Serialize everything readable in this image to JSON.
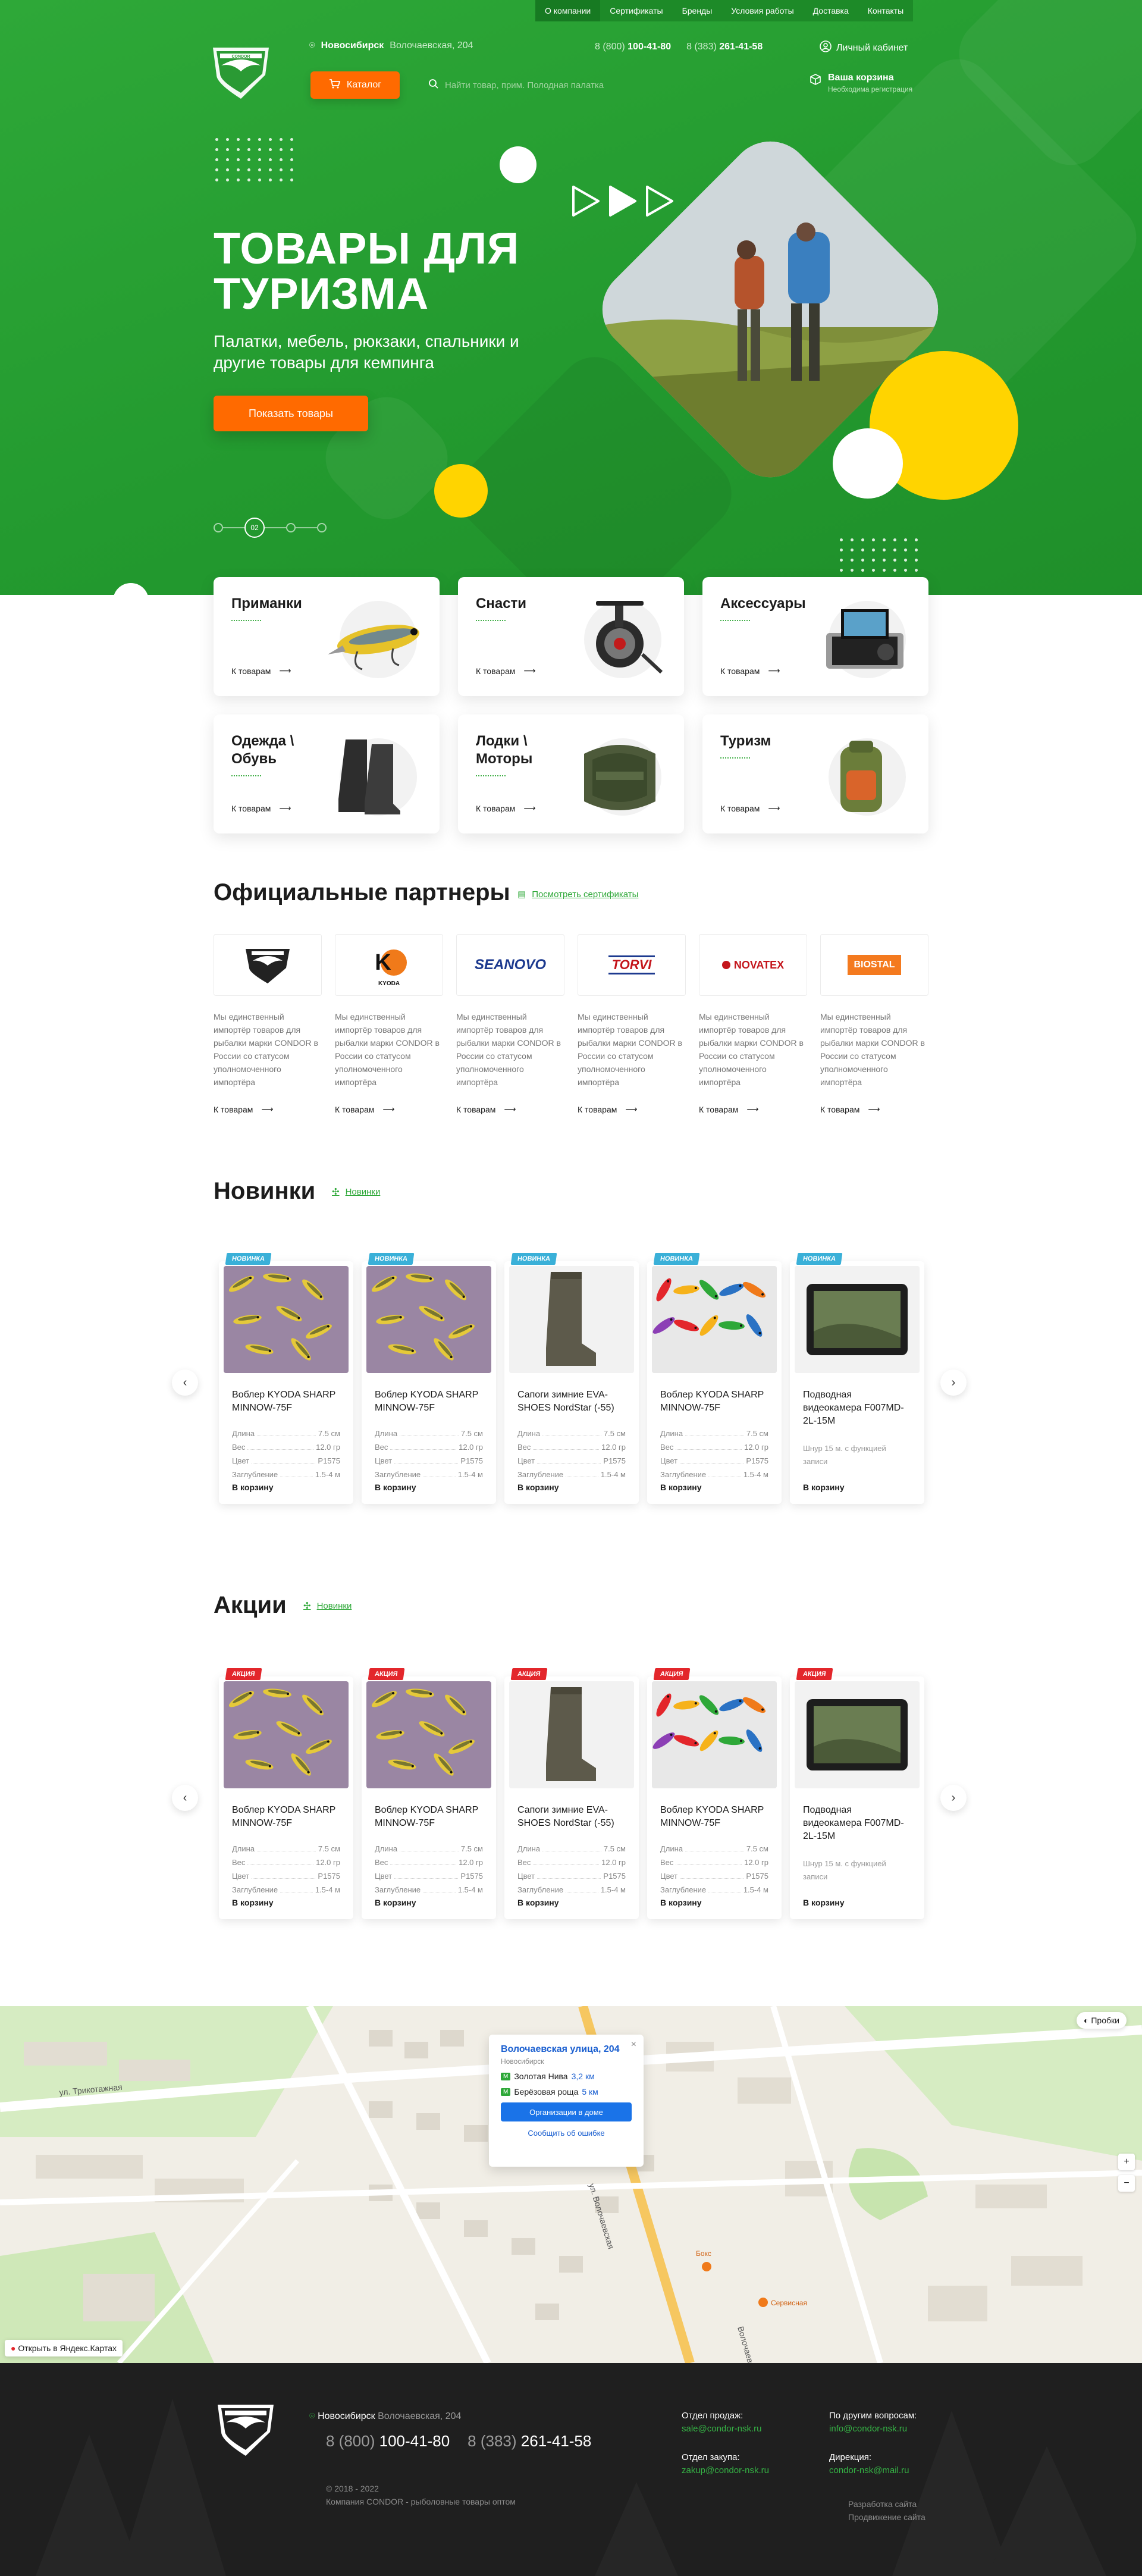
{
  "topnav": {
    "items": [
      "О компании",
      "Сертификаты",
      "Бренды",
      "Условия работы",
      "Доставка",
      "Контакты"
    ]
  },
  "header": {
    "city": "Новосибирск",
    "address": "Волочаевская, 204",
    "phone1_prefix": "8 (800)",
    "phone1": "100-41-80",
    "phone2_prefix": "8 (383)",
    "phone2": "261-41-58",
    "cabinet": "Личный кабинет",
    "catalog": "Каталог",
    "search_placeholder": "Найти товар, прим. Полодная палатка",
    "cart_title": "Ваша корзина",
    "cart_sub": "Необходима регистрация"
  },
  "hero": {
    "title_line1": "ТОВАРЫ ДЛЯ",
    "title_line2": "ТУРИЗМА",
    "subtitle": "Палатки, мебель, рюкзаки, спальники и другие товары для кемпинга",
    "button": "Показать товары",
    "slide": "02"
  },
  "categories": [
    {
      "title": "Приманки",
      "link": "К товарам",
      "icon": "lure-icon"
    },
    {
      "title": "Снасти",
      "link": "К товарам",
      "icon": "reel-icon"
    },
    {
      "title": "Аксессуары",
      "link": "К товарам",
      "icon": "camera-case-icon"
    },
    {
      "title": "Одежда \\ Обувь",
      "link": "К товарам",
      "icon": "boots-icon"
    },
    {
      "title": "Лодки \\ Моторы",
      "link": "К товарам",
      "icon": "boat-icon"
    },
    {
      "title": "Туризм",
      "link": "К товарам",
      "icon": "backpack-icon"
    }
  ],
  "partners_section": {
    "title": "Официальные партнеры",
    "link": "Посмотреть сертификаты",
    "items": [
      {
        "logo": "CONDOR",
        "text": "Мы единственный импортёр товаров для рыбалки марки CONDOR в России со статусом уполномоченного импортёра",
        "link": "К товарам"
      },
      {
        "logo": "KYODA",
        "text": "Мы единственный импортёр товаров для рыбалки марки CONDOR в России со статусом уполномоченного импортёра",
        "link": "К товарам"
      },
      {
        "logo": "SEANOVO",
        "text": "Мы единственный импортёр товаров для рыбалки марки CONDOR в России со статусом уполномоченного импортёра",
        "link": "К товарам"
      },
      {
        "logo": "TORVI",
        "text": "Мы единственный импортёр товаров для рыбалки марки CONDOR в России со статусом уполномоченного импортёра",
        "link": "К товарам"
      },
      {
        "logo": "NOVATEX",
        "text": "Мы единственный импортёр товаров для рыбалки марки CONDOR в России со статусом уполномоченного импортёра",
        "link": "К товарам"
      },
      {
        "logo": "BIOSTAL",
        "text": "Мы единственный импортёр товаров для рыбалки марки CONDOR в России со статусом уполномоченного импортёра",
        "link": "К товарам"
      }
    ]
  },
  "new_section": {
    "title": "Новинки",
    "link": "Новинки",
    "badge": "НОВИНКА",
    "badge_color": "#3ab0d8",
    "products": [
      {
        "name": "Воблер KYODA SHARP MINNOW-75F",
        "type": "lures",
        "specs": [
          [
            "Длина",
            "7.5 см"
          ],
          [
            "Вес",
            "12.0 гр"
          ],
          [
            "Цвет",
            "P1575"
          ],
          [
            "Заглубление",
            "1.5-4 м"
          ]
        ],
        "cart": "В корзину"
      },
      {
        "name": "Воблер KYODA SHARP MINNOW-75F",
        "type": "lures",
        "specs": [
          [
            "Длина",
            "7.5 см"
          ],
          [
            "Вес",
            "12.0 гр"
          ],
          [
            "Цвет",
            "P1575"
          ],
          [
            "Заглубление",
            "1.5-4 м"
          ]
        ],
        "cart": "В корзину"
      },
      {
        "name": "Сапоги зимние EVA-SHOES NordStar (-55)",
        "type": "boots",
        "specs": [
          [
            "Длина",
            "7.5 см"
          ],
          [
            "Вес",
            "12.0 гр"
          ],
          [
            "Цвет",
            "P1575"
          ],
          [
            "Заглубление",
            "1.5-4 м"
          ]
        ],
        "cart": "В корзину"
      },
      {
        "name": "Воблер KYODA SHARP MINNOW-75F",
        "type": "colorful",
        "specs": [
          [
            "Длина",
            "7.5 см"
          ],
          [
            "Вес",
            "12.0 гр"
          ],
          [
            "Цвет",
            "P1575"
          ],
          [
            "Заглубление",
            "1.5-4 м"
          ]
        ],
        "cart": "В корзину"
      },
      {
        "name": "Подводная видеокамера F007MD-2L-15M",
        "type": "camera",
        "desc": "Шнур 15 м. с функцией записи",
        "cart": "В корзину"
      }
    ]
  },
  "sale_section": {
    "title": "Акции",
    "link": "Новинки",
    "badge": "АКЦИЯ",
    "badge_color": "#e3262b",
    "products": [
      {
        "name": "Воблер KYODA SHARP MINNOW-75F",
        "type": "lures",
        "specs": [
          [
            "Длина",
            "7.5 см"
          ],
          [
            "Вес",
            "12.0 гр"
          ],
          [
            "Цвет",
            "P1575"
          ],
          [
            "Заглубление",
            "1.5-4 м"
          ]
        ],
        "cart": "В корзину"
      },
      {
        "name": "Воблер KYODA SHARP MINNOW-75F",
        "type": "lures",
        "specs": [
          [
            "Длина",
            "7.5 см"
          ],
          [
            "Вес",
            "12.0 гр"
          ],
          [
            "Цвет",
            "P1575"
          ],
          [
            "Заглубление",
            "1.5-4 м"
          ]
        ],
        "cart": "В корзину"
      },
      {
        "name": "Сапоги зимние EVA-SHOES NordStar (-55)",
        "type": "boots",
        "specs": [
          [
            "Длина",
            "7.5 см"
          ],
          [
            "Вес",
            "12.0 гр"
          ],
          [
            "Цвет",
            "P1575"
          ],
          [
            "Заглубление",
            "1.5-4 м"
          ]
        ],
        "cart": "В корзину"
      },
      {
        "name": "Воблер KYODA SHARP MINNOW-75F",
        "type": "colorful",
        "specs": [
          [
            "Длина",
            "7.5 см"
          ],
          [
            "Вес",
            "12.0 гр"
          ],
          [
            "Цвет",
            "P1575"
          ],
          [
            "Заглубление",
            "1.5-4 м"
          ]
        ],
        "cart": "В корзину"
      },
      {
        "name": "Подводная видеокамера F007MD-2L-15M",
        "type": "camera",
        "desc": "Шнур 15 м. с функцией записи",
        "cart": "В корзину"
      }
    ]
  },
  "map": {
    "address": "Волочаевская улица, 204",
    "city": "Новосибирск",
    "metro1": "Золотая Нива",
    "metro1_dist": "3,2 км",
    "metro2": "Берёзовая роща",
    "metro2_dist": "5 км",
    "orgs_button": "Организации в доме",
    "report": "Сообщить об ошибке",
    "open_link": "Открыть в Яндекс.Картах",
    "traffic": "Пробки",
    "street1": "ул. Трикотажная",
    "street2": "ул. Волочаевская",
    "street3": "Волочаевская улица",
    "place1": "Бокс",
    "place2": "Сервисная"
  },
  "footer": {
    "city": "Новосибирск",
    "address": "Волочаевская, 204",
    "phone1_prefix": "8 (800)",
    "phone1": "100-41-80",
    "phone2_prefix": "8 (383)",
    "phone2": "261-41-58",
    "copyright_years": "© 2018 - 2022",
    "copyright_text": "Компания CONDOR - рыболовные товары оптом",
    "sales_title": "Отдел продаж:",
    "sales_email": "sale@condor-nsk.ru",
    "purchase_title": "Отдел закупа:",
    "purchase_email": "zakup@condor-nsk.ru",
    "other_title": "По другим вопросам:",
    "other_email": "info@condor-nsk.ru",
    "director_title": "Дирекция:",
    "director_email": "condor-nsk@mail.ru",
    "dev1": "Разработка сайта",
    "dev2": "Продвижение сайта"
  }
}
